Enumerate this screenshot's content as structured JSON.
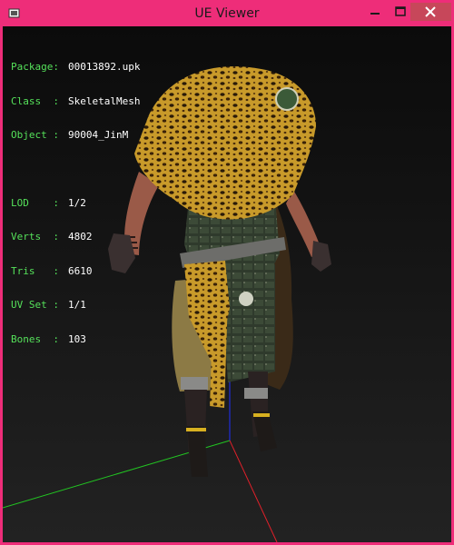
{
  "window": {
    "title": "UE Viewer"
  },
  "info": {
    "package": {
      "label": "Package:",
      "value": "00013892.upk"
    },
    "class": {
      "label": "Class  :",
      "value": "SkeletalMesh"
    },
    "object": {
      "label": "Object :",
      "value": "90004_JinM"
    },
    "lod": {
      "label": "LOD    :",
      "value": "1/2"
    },
    "verts": {
      "label": "Verts  :",
      "value": "4802"
    },
    "tris": {
      "label": "Tris   :",
      "value": "6610"
    },
    "uvset": {
      "label": "UV Set :",
      "value": "1/1"
    },
    "bones": {
      "label": "Bones  :",
      "value": "103"
    }
  },
  "colors": {
    "title_bar": "#ee2d79",
    "close_button": "#c7475a",
    "hud_label": "#55e15a",
    "hud_value": "#ffffff",
    "axis_x": "#e0202a",
    "axis_y": "#22c522",
    "axis_z": "#2030ff"
  }
}
